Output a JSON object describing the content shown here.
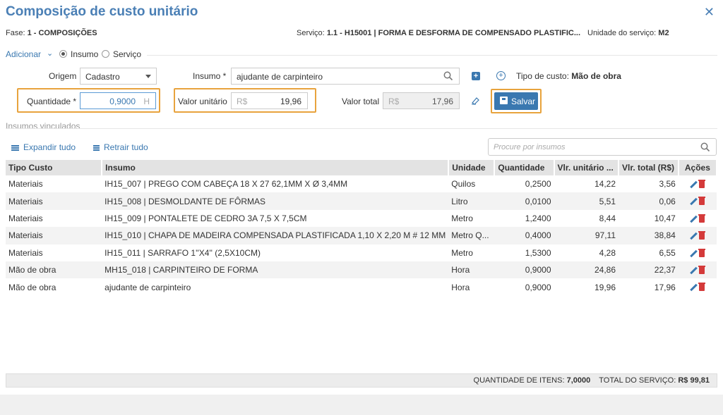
{
  "title": "Composição de custo unitário",
  "info": {
    "fase_label": "Fase:",
    "fase_value": "1 - COMPOSIÇÕES",
    "servico_label": "Serviço:",
    "servico_value": "1.1 - H15001 | FORMA E DESFORMA DE COMPENSADO PLASTIFIC...",
    "unidade_label": "Unidade do serviço:",
    "unidade_value": "M2"
  },
  "add": {
    "label": "Adicionar",
    "options": [
      "Insumo",
      "Serviço"
    ],
    "selected": "Insumo"
  },
  "form": {
    "origem_label": "Origem",
    "origem_value": "Cadastro",
    "insumo_label": "Insumo *",
    "insumo_value": "ajudante de carpinteiro",
    "tipo_custo_label": "Tipo de custo:",
    "tipo_custo_value": "Mão de obra",
    "quantidade_label": "Quantidade *",
    "quantidade_value": "0,9000",
    "quantidade_unit": "H",
    "valor_unitario_label": "Valor unitário",
    "valor_unitario_prefix": "R$",
    "valor_unitario_value": "19,96",
    "valor_total_label": "Valor total",
    "valor_total_prefix": "R$",
    "valor_total_value": "17,96",
    "salvar_label": "Salvar"
  },
  "section": {
    "title": "Insumos vinculados",
    "expand_label": "Expandir tudo",
    "collapse_label": "Retrair tudo",
    "search_placeholder": "Procure por insumos"
  },
  "table": {
    "headers": [
      "Tipo Custo",
      "Insumo",
      "Unidade",
      "Quantidade",
      "Vlr. unitário ...",
      "Vlr. total (R$)",
      "Ações"
    ],
    "rows": [
      [
        "Materiais",
        "IH15_007 | PREGO COM CABEÇA 18 X 27 62,1MM X Ø 3,4MM",
        "Quilos",
        "0,2500",
        "14,22",
        "3,56"
      ],
      [
        "Materiais",
        "IH15_008 | DESMOLDANTE DE FÔRMAS",
        "Litro",
        "0,0100",
        "5,51",
        "0,06"
      ],
      [
        "Materiais",
        "IH15_009 | PONTALETE DE CEDRO 3A 7,5 X 7,5CM",
        "Metro",
        "1,2400",
        "8,44",
        "10,47"
      ],
      [
        "Materiais",
        "IH15_010 | CHAPA DE MADEIRA COMPENSADA PLASTIFICADA 1,10 X 2,20 M # 12 MM",
        "Metro Q...",
        "0,4000",
        "97,11",
        "38,84"
      ],
      [
        "Materiais",
        "IH15_011 | SARRAFO 1''X4'' (2,5X10CM)",
        "Metro",
        "1,5300",
        "4,28",
        "6,55"
      ],
      [
        "Mão de obra",
        "MH15_018 | CARPINTEIRO DE FORMA",
        "Hora",
        "0,9000",
        "24,86",
        "22,37"
      ],
      [
        "Mão de obra",
        "ajudante de carpinteiro",
        "Hora",
        "0,9000",
        "19,96",
        "17,96"
      ]
    ]
  },
  "footer": {
    "qtd_label": "QUANTIDADE DE ITENS:",
    "qtd_value": "7,0000",
    "total_label": "TOTAL DO SERVIÇO:",
    "total_value": "R$ 99,81"
  },
  "colors": {
    "accent": "#3a78b0",
    "title": "#4a7fb5",
    "highlight": "#e8a33d",
    "delete": "#d43a3a"
  },
  "icons": [
    "close-icon",
    "chevron-down-icon",
    "search-icon",
    "add-icon",
    "add-circle-icon",
    "eraser-icon",
    "save-icon",
    "list-icon",
    "edit-icon",
    "trash-icon"
  ]
}
